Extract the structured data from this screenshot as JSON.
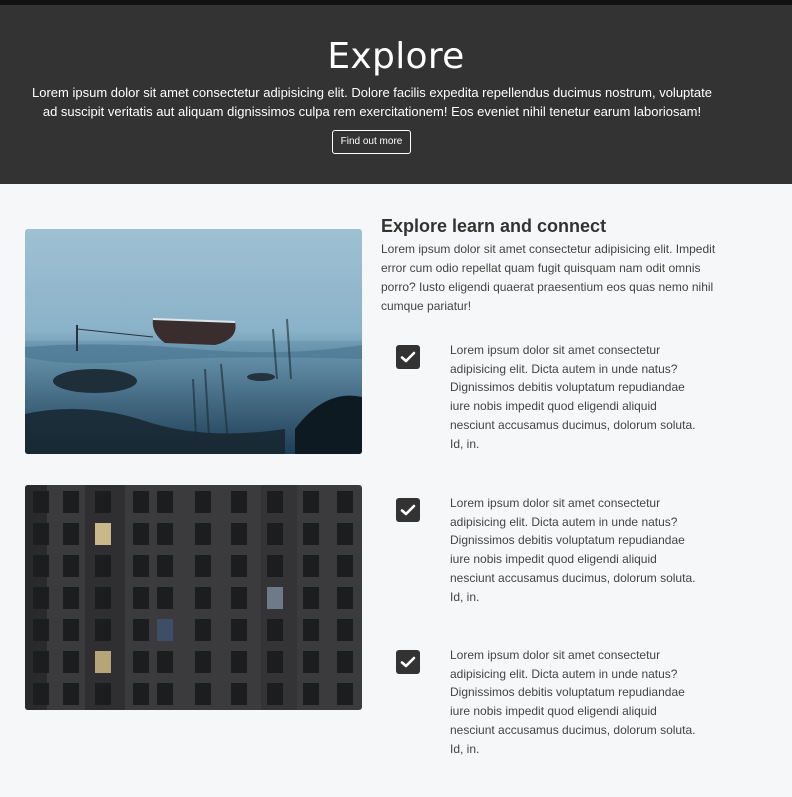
{
  "hero": {
    "title": "Explore",
    "text": "Lorem ipsum dolor sit amet consectetur adipisicing elit. Dolore facilis expedita repellendus ducimus nostrum, voluptate ad suscipit veritatis aut aliquam dignissimos culpa rem exercitationem! Eos eveniet nihil tenetur earum laboriosam!",
    "button_label": "Find out more"
  },
  "section": {
    "title": "Explore learn and connect",
    "text": "Lorem ipsum dolor sit amet consectetur adipisicing elit. Impedit error cum odio repellat quam fugit quisquam nam odit omnis porro? Iusto eligendi quaerat praesentium eos quas nemo nihil cumque pariatur!"
  },
  "images": [
    {
      "icon": "boat-photo"
    },
    {
      "icon": "building-photo"
    }
  ],
  "features": [
    {
      "icon": "checkbox-checked-icon",
      "text": "Lorem ipsum dolor sit amet consectetur adipisicing elit. Dicta autem in unde natus? Dignissimos debitis voluptatum repudiandae iure nobis impedit quod eligendi aliquid nesciunt accusamus ducimus, dolorum soluta. Id, in."
    },
    {
      "icon": "checkbox-checked-icon",
      "text": "Lorem ipsum dolor sit amet consectetur adipisicing elit. Dicta autem in unde natus? Dignissimos debitis voluptatum repudiandae iure nobis impedit quod eligendi aliquid nesciunt accusamus ducimus, dolorum soluta. Id, in."
    },
    {
      "icon": "checkbox-checked-icon",
      "text": "Lorem ipsum dolor sit amet consectetur adipisicing elit. Dicta autem in unde natus? Dignissimos debitis voluptatum repudiandae iure nobis impedit quod eligendi aliquid nesciunt accusamus ducimus, dolorum soluta. Id, in."
    }
  ],
  "colors": {
    "hero_background": "#333333",
    "page_background": "#f6f7f8",
    "text": "#444444"
  }
}
